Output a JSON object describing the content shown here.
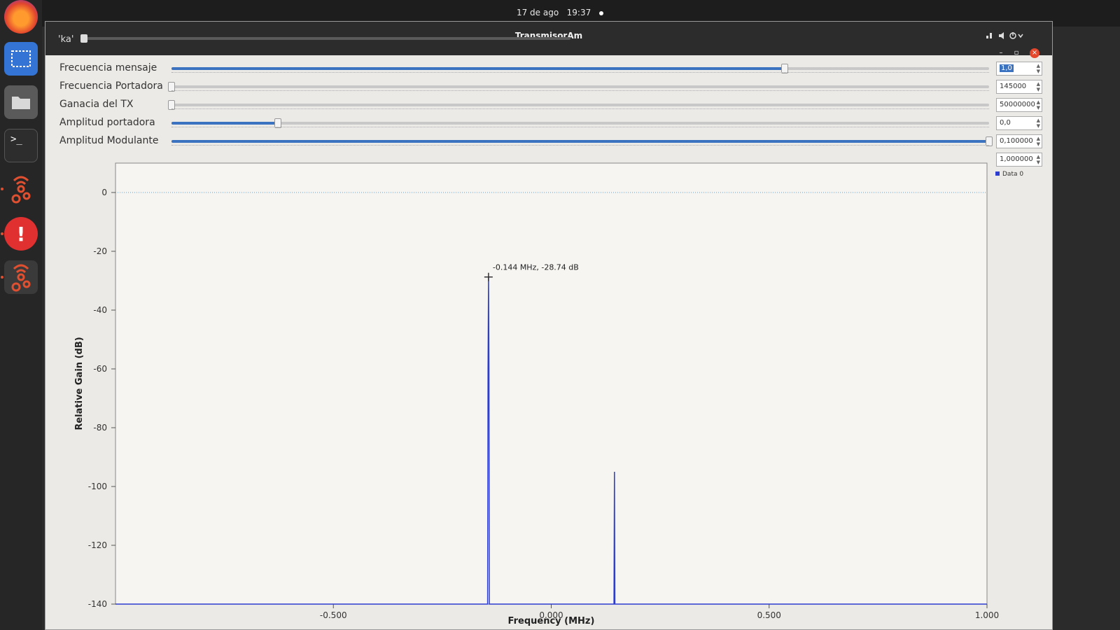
{
  "system": {
    "date": "17 de ago",
    "time": "19:37"
  },
  "dock": {
    "items": [
      "firefox-icon",
      "screenshot-icon",
      "files-icon",
      "terminal-icon",
      "gnuradio-icon",
      "alert-icon",
      "gnuradio-icon"
    ],
    "terminal_glyph": ">_"
  },
  "window": {
    "title": "TransmisorAm"
  },
  "ka": {
    "label": "'ka'"
  },
  "controls": [
    {
      "label": "Frecuencia mensaje",
      "value": "1,0",
      "position": 0.75,
      "filled": true,
      "selected": true
    },
    {
      "label": "Frecuencia Portadora",
      "value": "145000",
      "position": 0.0,
      "filled": false,
      "selected": false
    },
    {
      "label": "Ganacia del TX",
      "value": "50000000",
      "position": 0.0,
      "filled": false,
      "selected": false
    },
    {
      "label": "Amplitud portadora",
      "value": "0,0",
      "position": 0.13,
      "filled": true,
      "selected": false
    },
    {
      "label": "Amplitud Modulante",
      "value": "0,100000",
      "position": 1.0,
      "filled": true,
      "selected": false
    },
    {
      "label": "",
      "value": "1,000000",
      "position": null,
      "filled": false,
      "selected": false
    }
  ],
  "chart_data": {
    "type": "line",
    "xlabel": "Frequency (MHz)",
    "ylabel": "Relative Gain (dB)",
    "xlim": [
      -1.0,
      1.0
    ],
    "ylim": [
      -140,
      10
    ],
    "x_ticks": [
      -0.5,
      0.0,
      0.5,
      1.0
    ],
    "x_tick_labels": [
      "-0.500",
      "0.000",
      "0.500",
      "1.000"
    ],
    "y_ticks": [
      0,
      -20,
      -40,
      -60,
      -80,
      -100,
      -120,
      -140
    ],
    "y_tick_labels": [
      "0",
      "-20",
      "-40",
      "-60",
      "-80",
      "-100",
      "-120",
      "-140"
    ],
    "legend": [
      "Data 0"
    ],
    "legend_position": "top-right",
    "series": [
      {
        "name": "Data 0",
        "color": "#2d3dd0",
        "x": [
          -1.0,
          -0.146,
          -0.145,
          -0.144,
          -0.143,
          -0.142,
          0.144,
          0.145,
          0.146,
          1.0
        ],
        "y": [
          -140,
          -140,
          -60,
          -28.74,
          -60,
          -140,
          -140,
          -95,
          -140,
          -140
        ]
      }
    ],
    "marker": {
      "x": -0.144,
      "y": -28.74,
      "label": "-0.144 MHz, -28.74 dB"
    }
  }
}
